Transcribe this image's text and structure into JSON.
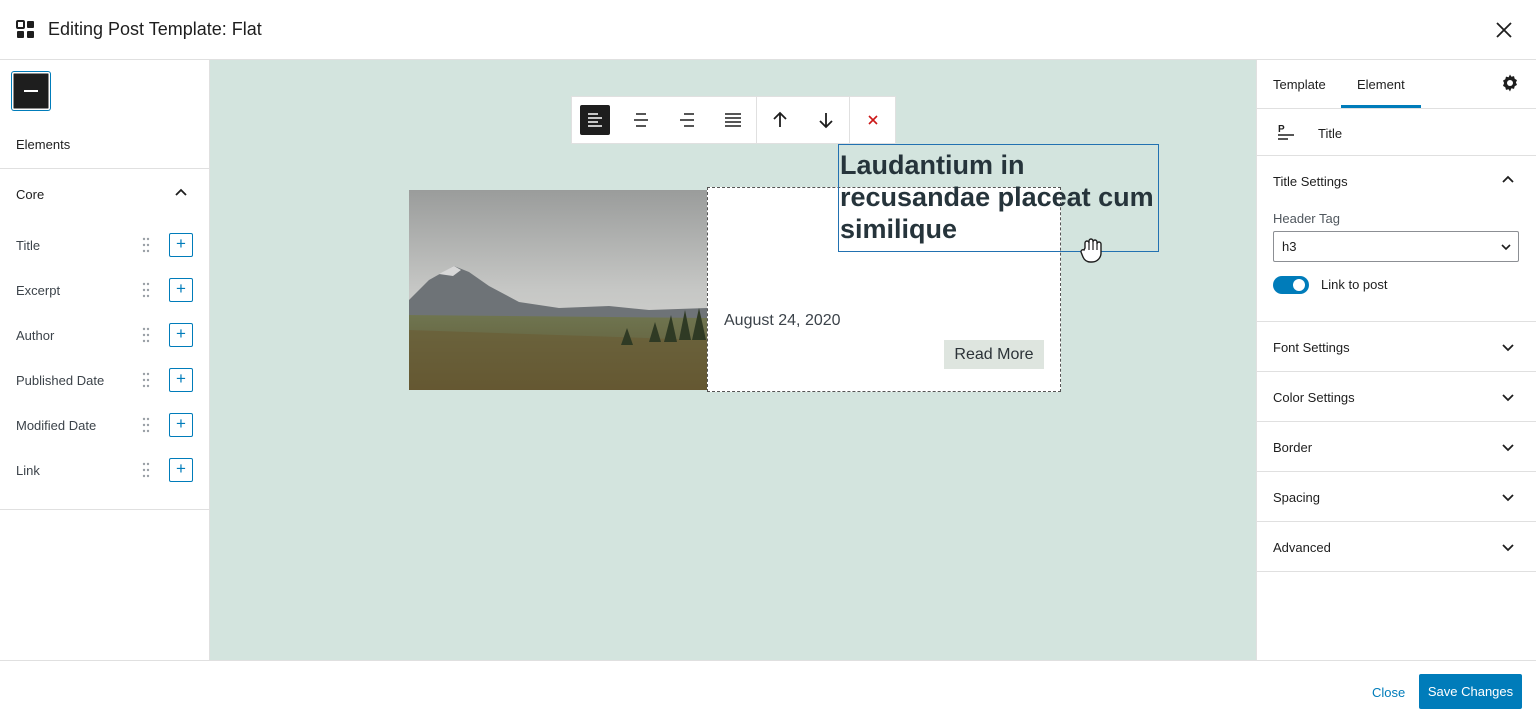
{
  "header": {
    "title": "Editing Post Template: Flat"
  },
  "left": {
    "elements_label": "Elements",
    "group_label": "Core",
    "items": [
      {
        "label": "Title"
      },
      {
        "label": "Excerpt"
      },
      {
        "label": "Author"
      },
      {
        "label": "Published Date"
      },
      {
        "label": "Modified Date"
      },
      {
        "label": "Link"
      }
    ],
    "add_symbol": "+"
  },
  "canvas": {
    "post_title": "Laudantium in recusandae placeat cum similique",
    "date": "August 24, 2020",
    "read_more": "Read More",
    "toolbar": {
      "remove_symbol": "✕"
    }
  },
  "right": {
    "tabs": [
      {
        "label": "Template"
      },
      {
        "label": "Element"
      }
    ],
    "active_tab": "Element",
    "element_name": "Title",
    "sections": {
      "title_settings": "Title Settings",
      "header_tag_label": "Header Tag",
      "header_tag_value": "h3",
      "link_to_post_label": "Link to post",
      "link_to_post": true,
      "font_settings": "Font Settings",
      "color_settings": "Color Settings",
      "border": "Border",
      "spacing": "Spacing",
      "advanced": "Advanced"
    }
  },
  "footer": {
    "close_label": "Close",
    "save_label": "Save Changes"
  },
  "colors": {
    "accent": "#007cba",
    "canvas_bg": "#d3e4de",
    "remove": "#cc1818"
  }
}
